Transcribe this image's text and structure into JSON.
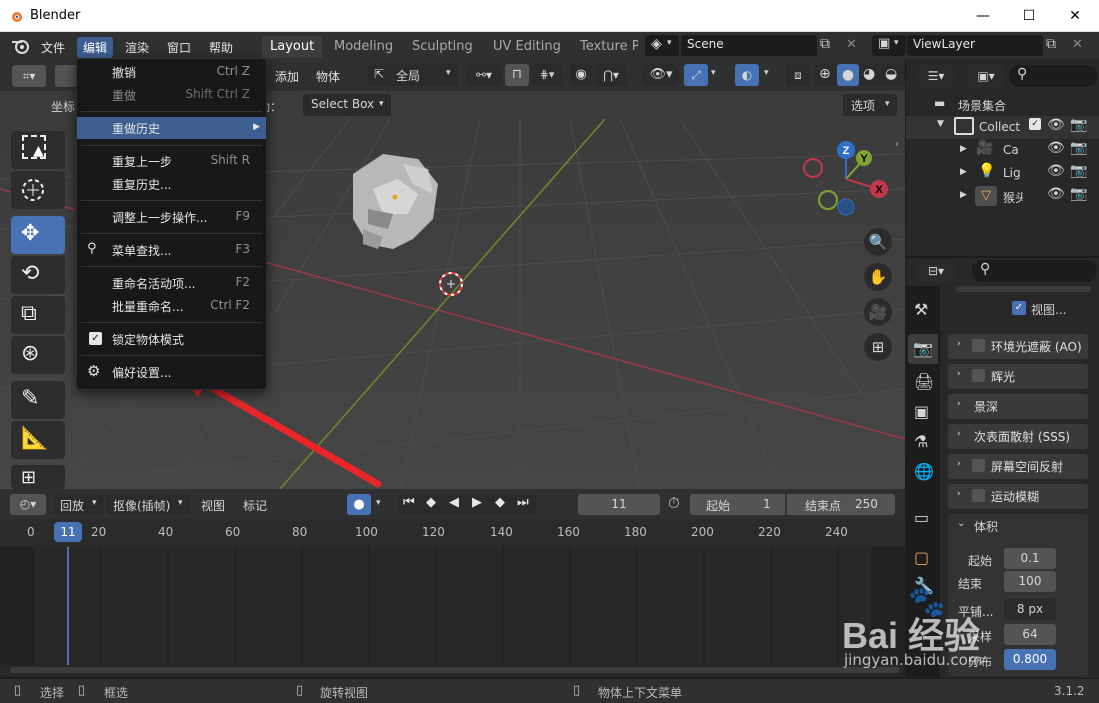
{
  "window": {
    "title": "Blender"
  },
  "menubar": {
    "items": [
      "文件",
      "编辑",
      "渲染",
      "窗口",
      "帮助"
    ]
  },
  "workspaces": [
    "Layout",
    "Modeling",
    "Sculpting",
    "UV Editing",
    "Texture P"
  ],
  "scene": {
    "name": "Scene",
    "view_layer": "ViewLayer"
  },
  "viewport_header": {
    "add": "添加",
    "object": "物体",
    "orientation": "全局",
    "coord_label": "坐标",
    "drag_label": "动：",
    "select_mode": "Select Box",
    "options": "选项"
  },
  "edit_menu": {
    "items": [
      {
        "label": "撤销",
        "shortcut": "Ctrl Z",
        "disabled": false
      },
      {
        "label": "重做",
        "shortcut": "Shift Ctrl Z",
        "disabled": true
      },
      {
        "label": "重做历史",
        "shortcut": "",
        "disabled": false
      },
      {
        "label": "重复上一步",
        "shortcut": "Shift R",
        "disabled": false
      },
      {
        "label": "重复历史...",
        "shortcut": "",
        "disabled": false
      },
      {
        "label": "调整上一步操作...",
        "shortcut": "F9",
        "disabled": false
      },
      {
        "label": "菜单查找...",
        "shortcut": "F3",
        "disabled": false
      },
      {
        "label": "重命名活动项...",
        "shortcut": "F2",
        "disabled": false
      },
      {
        "label": "批量重命名...",
        "shortcut": "Ctrl F2",
        "disabled": false
      },
      {
        "label": "锁定物体模式",
        "shortcut": "",
        "disabled": false
      },
      {
        "label": "偏好设置...",
        "shortcut": "",
        "disabled": false
      }
    ]
  },
  "timeline": {
    "playback": "回放",
    "keying": "抠像(插帧)",
    "view": "视图",
    "marker": "标记",
    "current_frame": "11",
    "start_label": "起始",
    "start": "1",
    "end_label": "结束点",
    "end": "250",
    "ticks": [
      "0",
      "11",
      "20",
      "40",
      "60",
      "80",
      "100",
      "120",
      "140",
      "160",
      "180",
      "200",
      "220",
      "240"
    ]
  },
  "outliner": {
    "scene_collection": "场景集合",
    "items": [
      "Collect",
      "Ca",
      "Lig",
      "猴头"
    ]
  },
  "properties": {
    "viewport_checkbox": "视图...",
    "panels": [
      "环境光遮蔽 (AO)",
      "辉光",
      "景深",
      "次表面散射 (SSS)",
      "屏幕空间反射",
      "运动模糊",
      "体积"
    ],
    "volume": {
      "start_label": "起始",
      "start": "0.1",
      "end_label": "结束",
      "end": "100",
      "tile_label": "平铺...",
      "tile": "8 px",
      "samples_label": "采样",
      "samples": "64",
      "distribution_label": "分布",
      "distribution": "0.800"
    }
  },
  "statusbar": {
    "select": "选择",
    "box_select": "框选",
    "rotate_view": "旋转视图",
    "context_menu": "物体上下文菜单",
    "version": "3.1.2"
  },
  "watermark": {
    "brand": "Bai 经验",
    "url": "jingyan.baidu.com"
  },
  "colors": {
    "accent": "#4772b3",
    "menu_highlight": "#3d5e91",
    "arrow": "#e8262a",
    "x_axis": "#c0394a",
    "y_axis": "#7fa530",
    "z_axis": "#2f6ec9"
  }
}
